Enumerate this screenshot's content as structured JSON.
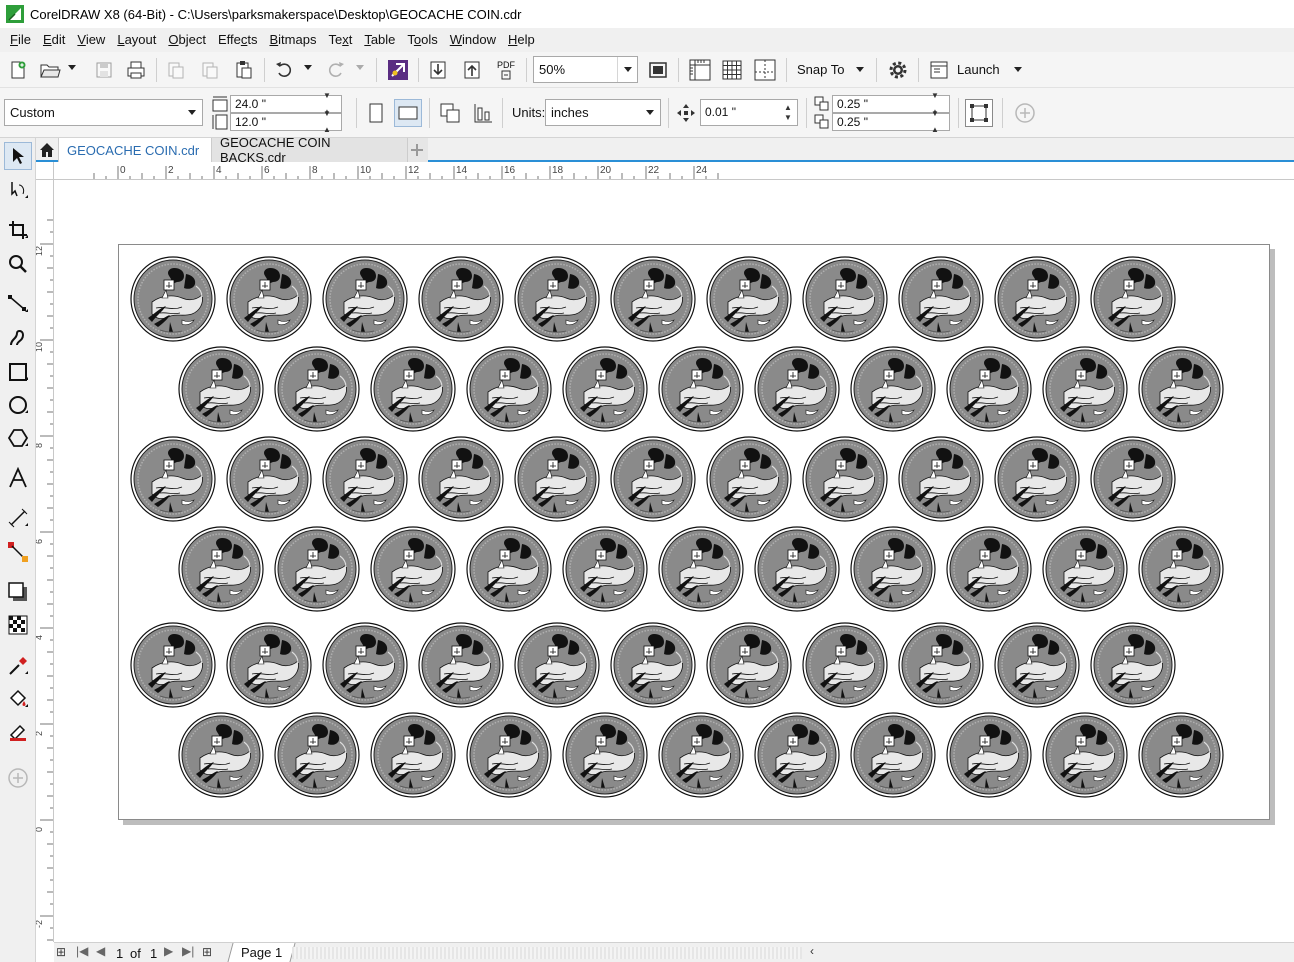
{
  "window": {
    "title": "CorelDRAW X8 (64-Bit) - C:\\Users\\parksmakerspace\\Desktop\\GEOCACHE COIN.cdr"
  },
  "menu": [
    {
      "label": "File",
      "key": "F",
      "rest": "ile"
    },
    {
      "label": "Edit",
      "key": "E",
      "rest": "dit"
    },
    {
      "label": "View",
      "key": "V",
      "rest": "iew"
    },
    {
      "label": "Layout",
      "key": "L",
      "rest": "ayout"
    },
    {
      "label": "Object",
      "key": "O",
      "rest": "bject"
    },
    {
      "label": "Effects",
      "pre": "Effe",
      "key": "c",
      "rest": "ts"
    },
    {
      "label": "Bitmaps",
      "key": "B",
      "rest": "itmaps"
    },
    {
      "label": "Text",
      "pre": "Te",
      "key": "x",
      "rest": "t"
    },
    {
      "label": "Table",
      "key": "T",
      "rest": "able"
    },
    {
      "label": "Tools",
      "pre": "T",
      "key": "o",
      "rest": "ols"
    },
    {
      "label": "Window",
      "key": "W",
      "rest": "indow"
    },
    {
      "label": "Help",
      "key": "H",
      "rest": "elp"
    }
  ],
  "standard_toolbar": {
    "pdf_label": "PDF",
    "zoom_level": "50%",
    "snap_to": "Snap To",
    "launch": "Launch"
  },
  "property_bar": {
    "page_preset": "Custom",
    "page_width": "24.0 \"",
    "page_height": "12.0 \"",
    "units_label": "Units:",
    "units_value": "inches",
    "nudge": "0.01 \"",
    "dup_x": "0.25 \"",
    "dup_y": "0.25 \""
  },
  "document_tabs": [
    {
      "label": "GEOCACHE COIN.cdr",
      "active": true
    },
    {
      "label": "GEOCACHE COIN BACKS.cdr",
      "active": false
    }
  ],
  "rulers": {
    "h_labels": [
      "0",
      "2",
      "4",
      "6",
      "8",
      "10",
      "12",
      "14",
      "16",
      "18",
      "20",
      "22",
      "24"
    ],
    "v_labels": [
      "12",
      "10",
      "8",
      "6",
      "4",
      "2",
      "0",
      "-2"
    ]
  },
  "coin_sheet": {
    "row_counts": [
      11,
      11,
      11,
      11,
      11,
      11
    ]
  },
  "status": {
    "current_page": "1",
    "of_label": "of",
    "total_pages": "1",
    "page_tab": "Page 1"
  },
  "colors": {
    "accent": "#2a8fd6",
    "coin_fill": "#8a8a8a",
    "page_shadow": "#bdbdbd"
  }
}
